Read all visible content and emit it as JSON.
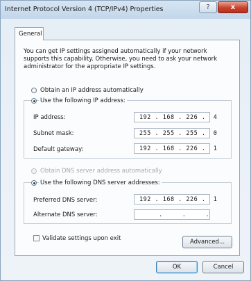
{
  "window": {
    "title": "Internet Protocol Version 4 (TCP/IPv4) Properties",
    "help_glyph": "?",
    "close_glyph": "x"
  },
  "tabs": [
    {
      "label": "General",
      "selected": true
    }
  ],
  "intro_text": "You can get IP settings assigned automatically if your network supports this capability. Otherwise, you need to ask your network administrator for the appropriate IP settings.",
  "ip_section": {
    "auto_label": "Obtain an IP address automatically",
    "manual_label": "Use the following IP address:",
    "selected": "manual",
    "fields": [
      {
        "label": "IP address:",
        "value": "192 . 168 . 226 .  4"
      },
      {
        "label": "Subnet mask:",
        "value": "255 . 255 . 255 .  0"
      },
      {
        "label": "Default gateway:",
        "value": "192 . 168 . 226 .  1"
      }
    ]
  },
  "dns_section": {
    "auto_label": "Obtain DNS server address automatically",
    "manual_label": "Use the following DNS server addresses:",
    "selected": "manual",
    "fields": [
      {
        "label": "Preferred DNS server:",
        "value": "192 . 168 . 226 .  1"
      },
      {
        "label": "Alternate DNS server:",
        "value": "     .     .     ."
      }
    ]
  },
  "validate": {
    "label": "Validate settings upon exit",
    "checked": false
  },
  "buttons": {
    "advanced": "Advanced...",
    "ok": "OK",
    "cancel": "Cancel"
  },
  "colors": {
    "close_button": "#c7422c",
    "default_button_border": "#3c7fb1",
    "panel": "#fbfcfd"
  }
}
